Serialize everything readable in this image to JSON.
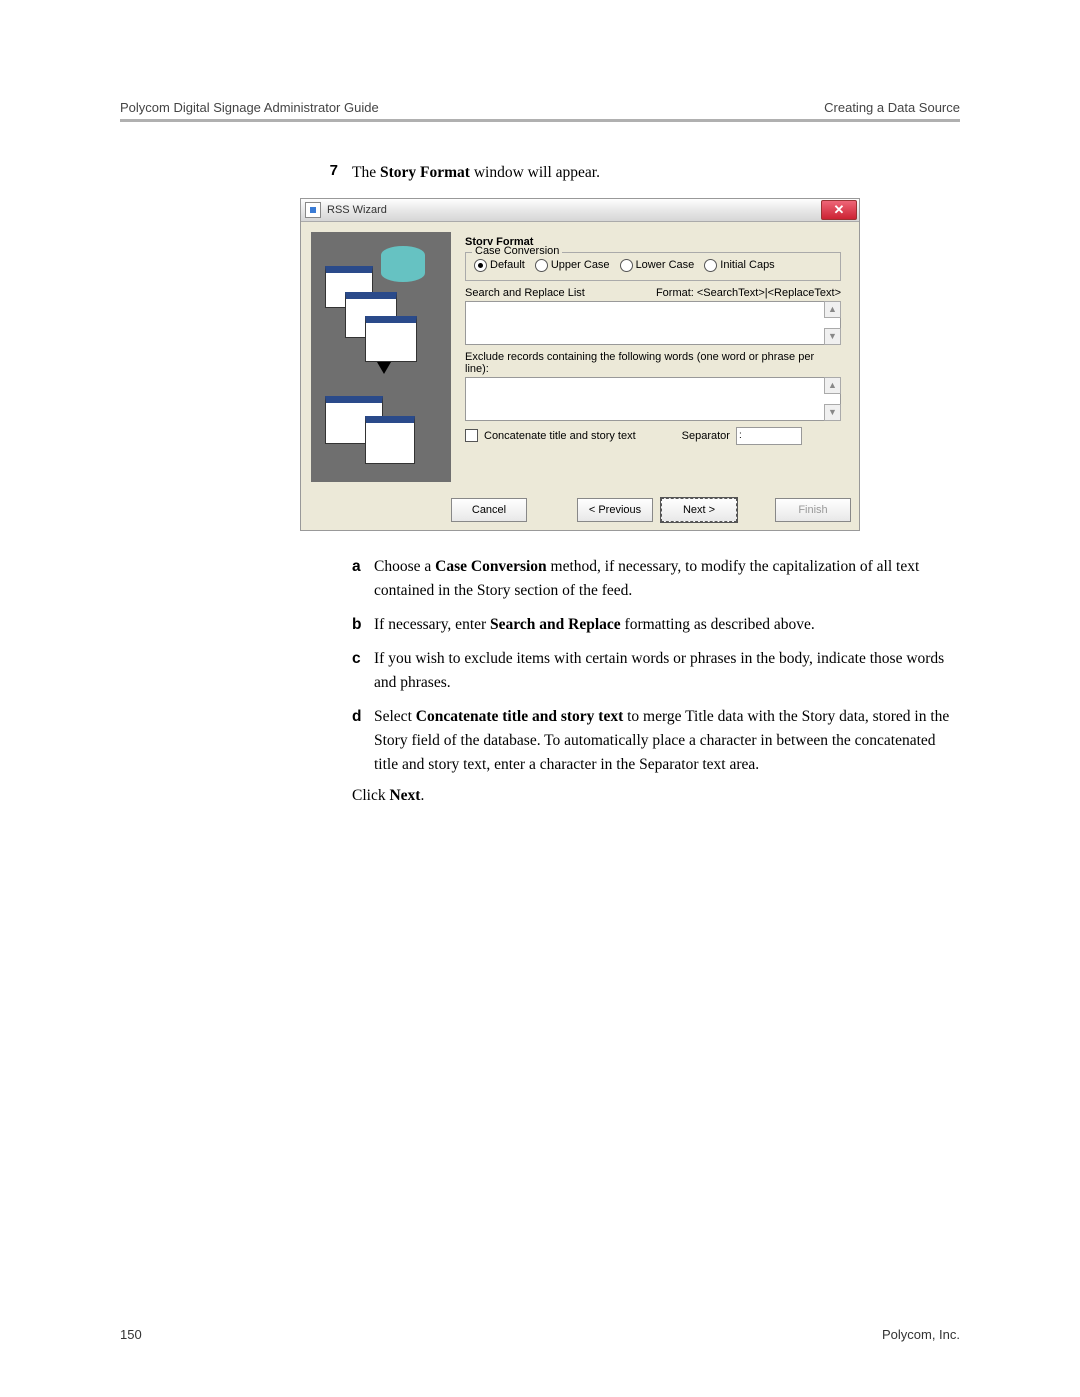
{
  "header": {
    "left": "Polycom Digital Signage Administrator Guide",
    "right": "Creating a Data Source"
  },
  "step": {
    "num": "7",
    "pre": "The",
    "bold": "Story Format",
    "post": "window will appear."
  },
  "win": {
    "title": "RSS Wizard",
    "panel_title": "Story Format",
    "case_legend": "Case Conversion",
    "radios": [
      "Default",
      "Upper Case",
      "Lower Case",
      "Initial Caps"
    ],
    "srl_label": "Search and Replace List",
    "format_hint": "Format: <SearchText>|<ReplaceText>",
    "exclude_label": "Exclude records containing the following words (one word or phrase per line):",
    "concat_label": "Concatenate title and story text",
    "sep_label": "Separator",
    "sep_value": ":",
    "buttons": [
      "Cancel",
      "< Previous",
      "Next >",
      "Finish"
    ]
  },
  "subs": [
    {
      "l": "a",
      "t1": "Choose a",
      "b1": "Case Conversion",
      "t2": "method, if necessary, to modify the capitalization of all text contained in the Story section of the feed."
    },
    {
      "l": "b",
      "t1": "If necessary, enter",
      "b1": "Search and Replace",
      "t2": "formatting as described above."
    },
    {
      "l": "c",
      "t1": "If you wish to exclude items with certain words or phrases in the body, indicate those words and phrases."
    },
    {
      "l": "d",
      "t1": "Select",
      "b1": "Concatenate title and story text",
      "t2": "to merge Title data with the Story data, stored in the Story field of the database. To automatically place a character in between the concatenated title and story text, enter a character in the Separator text area."
    }
  ],
  "click": {
    "pre": "Click",
    "bold": "Next",
    "post": "."
  },
  "footer": {
    "page": "150",
    "company": "Polycom, Inc."
  }
}
